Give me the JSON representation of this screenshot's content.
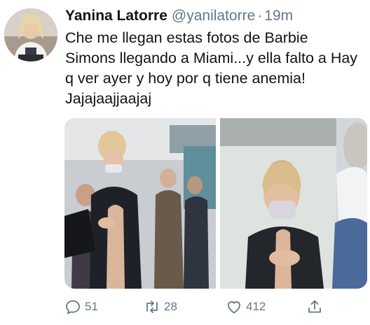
{
  "tweet": {
    "author_name": "Yanina Latorre",
    "author_handle": "@yanilatorre",
    "separator": "·",
    "time": "19m",
    "text_lines": [
      "Che me llegan estas fotos de Barbie",
      "Simons llegando a Miami...y ella falto a Hay",
      "q ver ayer y hoy por q tiene anemia!",
      "Jajajaajjaajaj"
    ],
    "media": [
      {
        "icon": "photo-airport-crowd"
      },
      {
        "icon": "photo-woman-closeup"
      }
    ]
  },
  "actions": {
    "reply_count": "51",
    "retweet_count": "28",
    "like_count": "412",
    "reply_icon": "reply-icon",
    "retweet_icon": "retweet-icon",
    "like_icon": "heart-icon",
    "share_icon": "share-icon"
  },
  "colors": {
    "text_primary": "#0f1419",
    "text_secondary": "#657786"
  }
}
